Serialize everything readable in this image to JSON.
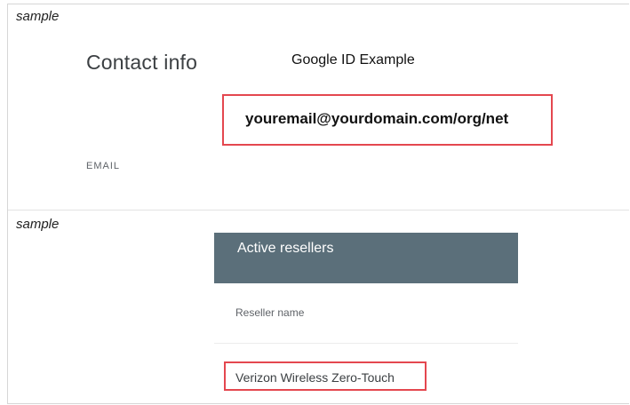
{
  "section1": {
    "sample_label": "sample",
    "contact_title": "Contact info",
    "google_id_example": "Google ID Example",
    "email_value": "youremail@yourdomain.com/org/net",
    "email_label": "EMAIL"
  },
  "section2": {
    "sample_label": "sample",
    "resellers_title": "Active resellers",
    "column_header": "Reseller name",
    "rows": [
      {
        "name": "Verizon Wireless Zero-Touch"
      }
    ]
  },
  "colors": {
    "highlight_border": "#e4474f",
    "header_background": "#5b6f7a"
  }
}
